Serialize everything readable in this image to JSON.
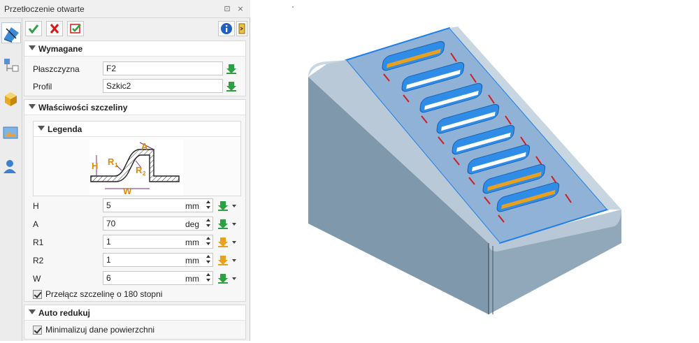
{
  "panel": {
    "title": "Przetłoczenie otwarte",
    "pin_glyph": "⊡",
    "close_glyph": "⨯"
  },
  "toolbar": {
    "ok_icon": "check-icon",
    "cancel_icon": "cross-icon",
    "apply_icon": "apply-check-icon",
    "info_icon": "info-icon",
    "help_icon": "help-icon"
  },
  "required": {
    "header": "Wymagane",
    "plane_label": "Płaszczyzna",
    "plane_value": "F2",
    "profile_label": "Profil",
    "profile_value": "Szkic2"
  },
  "slot": {
    "header": "Właściwości szczeliny",
    "legend_header": "Legenda",
    "legend_labels": {
      "a": "A",
      "h": "H",
      "r1": "R",
      "r1_sub": "1",
      "r2": "R",
      "r2_sub": "2",
      "w": "W"
    },
    "params": [
      {
        "label": "H",
        "value": "5",
        "unit": "mm"
      },
      {
        "label": "A",
        "value": "70",
        "unit": "deg"
      },
      {
        "label": "R1",
        "value": "1",
        "unit": "mm"
      },
      {
        "label": "R2",
        "value": "1",
        "unit": "mm"
      },
      {
        "label": "W",
        "value": "6",
        "unit": "mm"
      }
    ],
    "flip_label": "Przełącz szczelinę o 180 stopni",
    "flip_checked": true
  },
  "auto": {
    "header": "Auto redukuj",
    "minimize_label": "Minimalizuj dane powierzchni",
    "minimize_checked": true
  },
  "colors": {
    "accent_blue": "#2f7bd8",
    "face_blue": "#8fb2d6",
    "body_grey": "#8fa4b6",
    "arrow_red": "#d61a1a",
    "slot_orange": "#e8a020",
    "pick_green": "#2ea043"
  }
}
